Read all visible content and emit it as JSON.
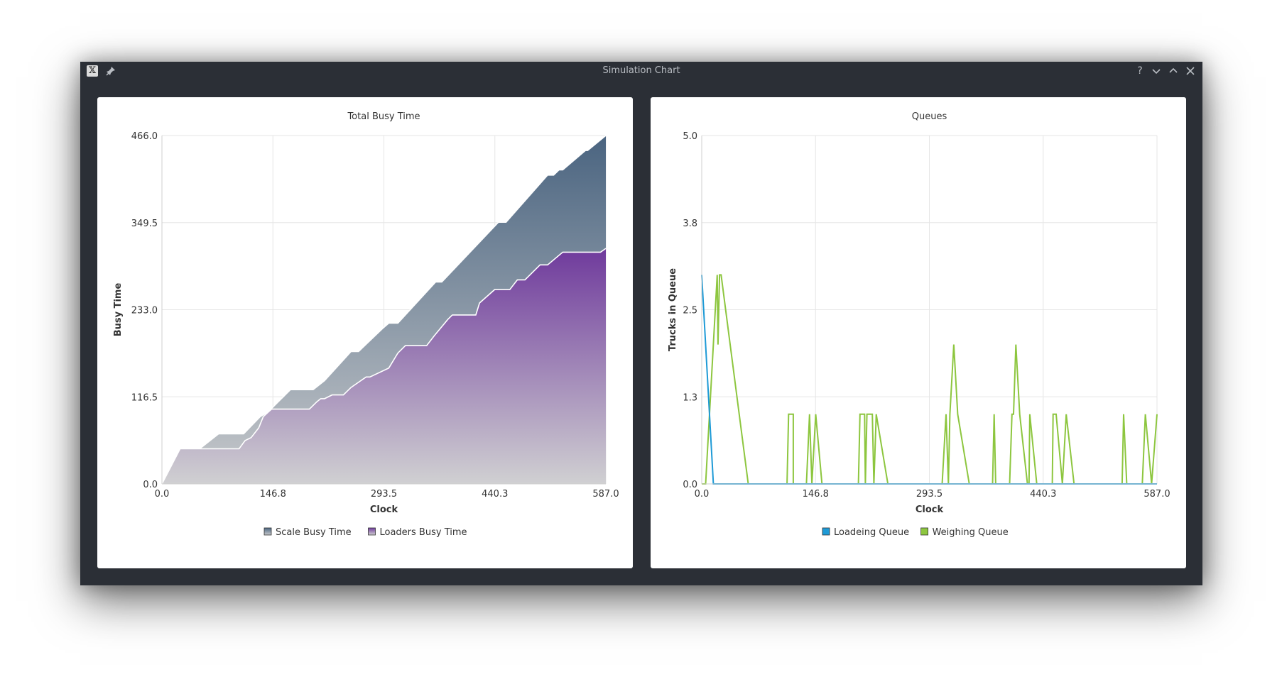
{
  "window": {
    "title": "Simulation Chart",
    "help_label": "?"
  },
  "colors": {
    "window_bg": "#2b2f36",
    "scale_top": "#4a6480",
    "scale_bottom": "#c8cacc",
    "loaders_top": "#6f3a9c",
    "loaders_bottom": "#d0d0d2",
    "loading_queue": "#1e9ad6",
    "weighing_queue": "#8dc63f"
  },
  "chart_data": [
    {
      "type": "area",
      "title": "Total Busy Time",
      "xlabel": "Clock",
      "ylabel": "Busy Time",
      "xlim": [
        0,
        587.0
      ],
      "ylim": [
        0,
        466.0
      ],
      "x_ticks": [
        "0.0",
        "146.8",
        "293.5",
        "440.3",
        "587.0"
      ],
      "y_ticks": [
        "0.0",
        "116.5",
        "233.0",
        "349.5",
        "466.0"
      ],
      "grid": true,
      "legend": "bottom",
      "series": [
        {
          "name": "Scale Busy Time",
          "points": [
            [
              0,
              0
            ],
            [
              24,
              47
            ],
            [
              50,
              47
            ],
            [
              75,
              67
            ],
            [
              108,
              67
            ],
            [
              130,
              90
            ],
            [
              140,
              96
            ],
            [
              170,
              126
            ],
            [
              200,
              126
            ],
            [
              215,
              138
            ],
            [
              250,
              177
            ],
            [
              260,
              177
            ],
            [
              292,
              208
            ],
            [
              300,
              215
            ],
            [
              312,
              215
            ],
            [
              362,
              270
            ],
            [
              370,
              270
            ],
            [
              445,
              350
            ],
            [
              455,
              350
            ],
            [
              510,
              413
            ],
            [
              518,
              413
            ],
            [
              525,
              420
            ],
            [
              530,
              420
            ],
            [
              560,
              446
            ],
            [
              563,
              446
            ],
            [
              587,
              466
            ]
          ]
        },
        {
          "name": "Loaders Busy Time",
          "points": [
            [
              0,
              0
            ],
            [
              24,
              47
            ],
            [
              50,
              47
            ],
            [
              75,
              47
            ],
            [
              102,
              47
            ],
            [
              110,
              58
            ],
            [
              118,
              62
            ],
            [
              128,
              75
            ],
            [
              134,
              90
            ],
            [
              145,
              100
            ],
            [
              154,
              100
            ],
            [
              195,
              100
            ],
            [
              205,
              110
            ],
            [
              210,
              114
            ],
            [
              215,
              114
            ],
            [
              225,
              119
            ],
            [
              240,
              119
            ],
            [
              250,
              129
            ],
            [
              270,
              143
            ],
            [
              275,
              143
            ],
            [
              300,
              155
            ],
            [
              312,
              175
            ],
            [
              322,
              185
            ],
            [
              350,
              185
            ],
            [
              360,
              198
            ],
            [
              378,
              220
            ],
            [
              384,
              226
            ],
            [
              415,
              226
            ],
            [
              420,
              242
            ],
            [
              440,
              260
            ],
            [
              460,
              260
            ],
            [
              470,
              273
            ],
            [
              480,
              273
            ],
            [
              500,
              293
            ],
            [
              510,
              293
            ],
            [
              530,
              310
            ],
            [
              580,
              310
            ],
            [
              587,
              315
            ]
          ]
        }
      ]
    },
    {
      "type": "line",
      "title": "Queues",
      "xlabel": "Clock",
      "ylabel": "Trucks in Queue",
      "xlim": [
        0,
        587.0
      ],
      "ylim": [
        0,
        5.0
      ],
      "x_ticks": [
        "0.0",
        "146.8",
        "293.5",
        "440.3",
        "587.0"
      ],
      "y_ticks": [
        "0.0",
        "1.3",
        "2.5",
        "3.8",
        "5.0"
      ],
      "grid": true,
      "legend": "bottom",
      "series": [
        {
          "name": "Loadeing Queue",
          "points": [
            [
              0,
              3
            ],
            [
              15,
              0
            ],
            [
              587,
              0
            ]
          ]
        },
        {
          "name": "Weighing Queue",
          "points": [
            [
              0,
              0
            ],
            [
              5,
              0
            ],
            [
              20,
              3
            ],
            [
              21,
              2
            ],
            [
              23,
              3
            ],
            [
              25,
              3
            ],
            [
              60,
              0
            ],
            [
              110,
              0
            ],
            [
              112,
              1
            ],
            [
              118,
              1
            ],
            [
              118,
              0
            ],
            [
              135,
              0
            ],
            [
              139,
              1
            ],
            [
              142,
              0
            ],
            [
              147,
              1
            ],
            [
              155,
              0
            ],
            [
              202,
              0
            ],
            [
              204,
              1
            ],
            [
              210,
              1
            ],
            [
              211,
              0
            ],
            [
              213,
              1
            ],
            [
              220,
              1
            ],
            [
              222,
              0
            ],
            [
              225,
              1
            ],
            [
              240,
              0
            ],
            [
              310,
              0
            ],
            [
              315,
              1
            ],
            [
              318,
              0
            ],
            [
              320,
              1
            ],
            [
              325,
              2
            ],
            [
              330,
              1
            ],
            [
              345,
              0
            ],
            [
              375,
              0
            ],
            [
              377,
              1
            ],
            [
              379,
              0
            ],
            [
              397,
              0
            ],
            [
              400,
              1
            ],
            [
              402,
              1
            ],
            [
              405,
              2
            ],
            [
              410,
              1
            ],
            [
              420,
              0
            ],
            [
              422,
              0
            ],
            [
              423,
              1
            ],
            [
              432,
              0
            ],
            [
              452,
              0
            ],
            [
              453,
              1
            ],
            [
              457,
              1
            ],
            [
              465,
              0
            ],
            [
              470,
              1
            ],
            [
              480,
              0
            ],
            [
              542,
              0
            ],
            [
              544,
              1
            ],
            [
              548,
              0
            ],
            [
              568,
              0
            ],
            [
              572,
              1
            ],
            [
              580,
              0
            ],
            [
              587,
              1
            ]
          ]
        }
      ]
    }
  ]
}
